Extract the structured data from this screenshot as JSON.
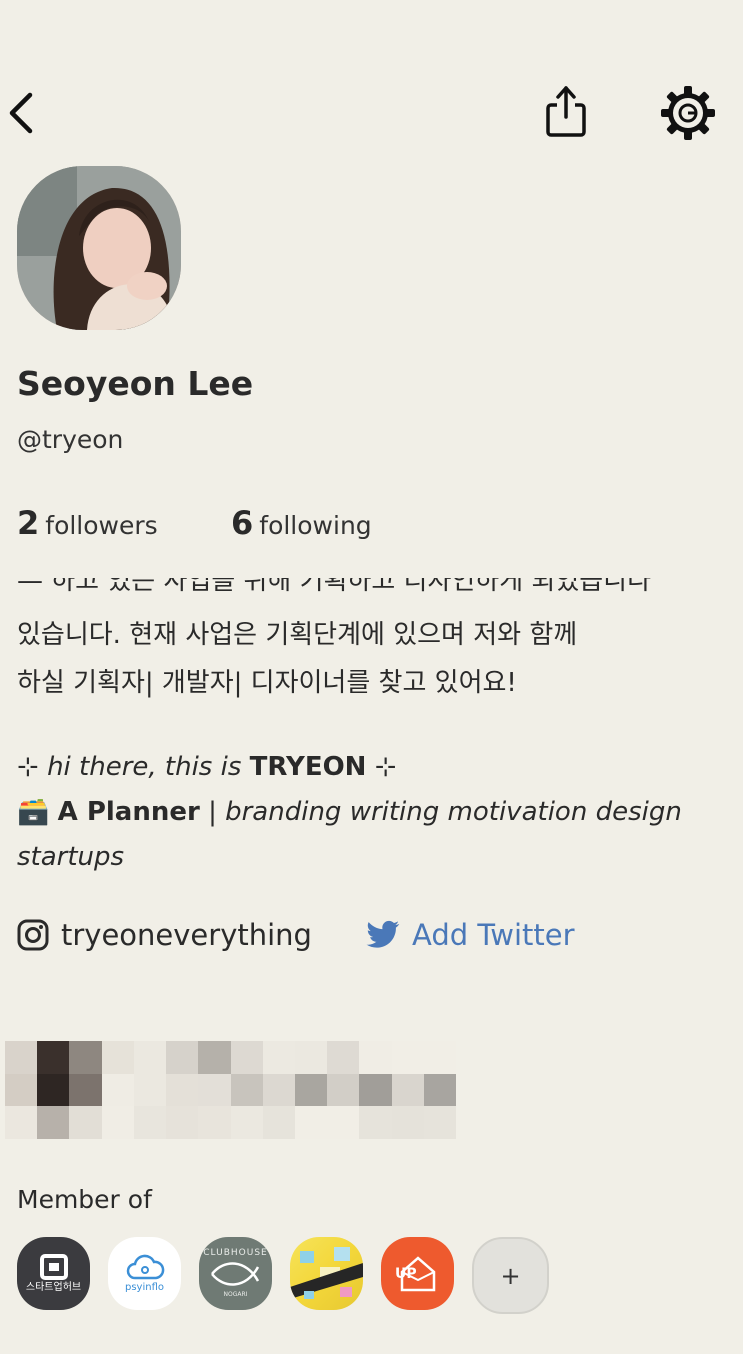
{
  "header": {
    "back_icon": "chevron-left-icon",
    "share_icon": "share-icon",
    "settings_icon": "settings-gear-icon"
  },
  "profile": {
    "name": "Seoyeon Lee",
    "handle": "@tryeon",
    "followers_count": "2",
    "followers_label": "followers",
    "following_count": "6",
    "following_label": "following"
  },
  "bio": {
    "line_cut": "— 하고 있는 사업을 위해 기획하고 디자인하게 되었습니다",
    "line1": "있습니다. 현재 사업은 기획단계에 있으며 저와 함께",
    "line2": "하실 기획자| 개발자| 디자이너를 찾고 있어요!",
    "sparkle": "⊹",
    "intro_pre": "hi there, this is",
    "intro_brand": "TRYEON",
    "role_emoji": "🗃️",
    "role_title": "A Planner",
    "role_sep": "|",
    "role_tags_1": "branding writing motivation design",
    "role_tags_2": "startups"
  },
  "social": {
    "instagram_label": "tryeoneverything",
    "twitter_label": "Add Twitter"
  },
  "member": {
    "title": "Member of",
    "clubs": [
      {
        "label": "스타트업허브"
      },
      {
        "label": "psyinflo"
      },
      {
        "label": "CLUBHOUSE",
        "sub": "NOGARI"
      },
      {
        "label": ""
      },
      {
        "label": "UP"
      }
    ],
    "add_label": "+"
  },
  "colors": {
    "background": "#f1efe7",
    "twitter_blue": "#4a78b8",
    "text": "#2a2a2a"
  }
}
